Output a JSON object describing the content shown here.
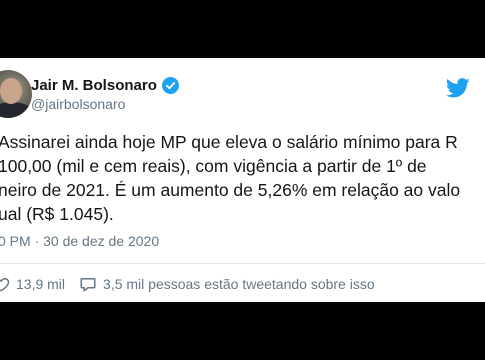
{
  "tweet": {
    "author_name": "Jair M. Bolsonaro",
    "handle": "@jairbolsonaro",
    "text_lines": [
      "Assinarei ainda hoje MP que eleva o salário mínimo para R",
      "100,00 (mil e cem reais), com vigência a partir de 1º de",
      "neiro de 2021. É um aumento de 5,26% em relação ao valo",
      "ual (R$ 1.045)."
    ],
    "timestamp": "0 PM · 30 de dez de 2020"
  },
  "actions": {
    "likes": "13,9 mil",
    "conversation": "3,5 mil pessoas estão tweetando sobre isso"
  },
  "icons": {
    "verified": "verified-badge-icon",
    "brand": "twitter-bird-icon",
    "like": "heart-icon",
    "conversation": "comment-icon"
  },
  "colors": {
    "brand": "#1da1f2",
    "text": "#14171a",
    "muted": "#657786"
  }
}
